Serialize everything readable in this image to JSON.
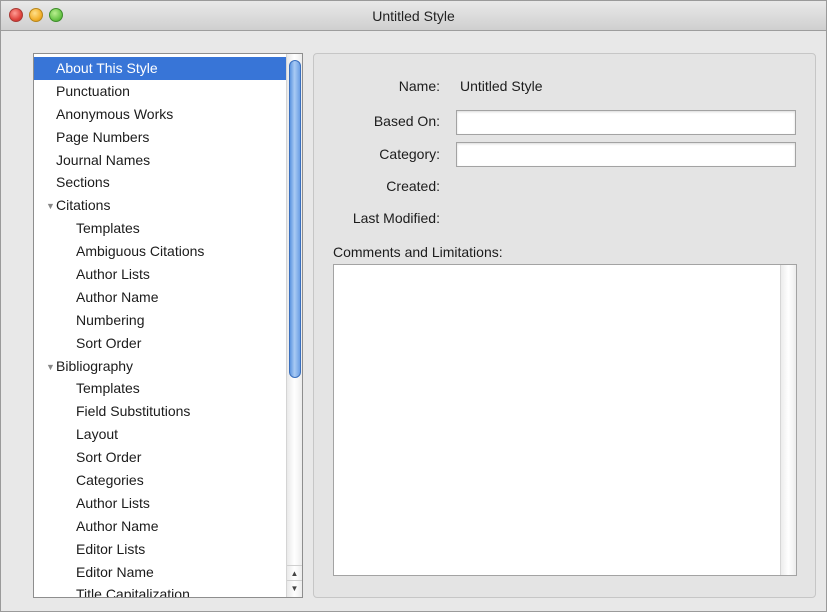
{
  "window": {
    "title": "Untitled Style"
  },
  "sidebar": {
    "items": [
      {
        "label": "About This Style",
        "level": 0,
        "selected": true
      },
      {
        "label": "Punctuation",
        "level": 0
      },
      {
        "label": "Anonymous Works",
        "level": 0
      },
      {
        "label": "Page Numbers",
        "level": 0
      },
      {
        "label": "Journal Names",
        "level": 0
      },
      {
        "label": "Sections",
        "level": 0
      },
      {
        "label": "Citations",
        "level": 0,
        "expanded": true
      },
      {
        "label": "Templates",
        "level": 1
      },
      {
        "label": "Ambiguous Citations",
        "level": 1
      },
      {
        "label": "Author Lists",
        "level": 1
      },
      {
        "label": "Author Name",
        "level": 1
      },
      {
        "label": "Numbering",
        "level": 1
      },
      {
        "label": "Sort Order",
        "level": 1
      },
      {
        "label": "Bibliography",
        "level": 0,
        "expanded": true
      },
      {
        "label": "Templates",
        "level": 1
      },
      {
        "label": "Field Substitutions",
        "level": 1
      },
      {
        "label": "Layout",
        "level": 1
      },
      {
        "label": "Sort Order",
        "level": 1
      },
      {
        "label": "Categories",
        "level": 1
      },
      {
        "label": "Author Lists",
        "level": 1
      },
      {
        "label": "Author Name",
        "level": 1
      },
      {
        "label": "Editor Lists",
        "level": 1
      },
      {
        "label": "Editor Name",
        "level": 1
      },
      {
        "label": "Title Capitalization",
        "level": 1
      }
    ],
    "disclosure_glyph": "▼",
    "scroll_up_glyph": "▲",
    "scroll_down_glyph": "▼"
  },
  "form": {
    "name_label": "Name:",
    "name_value": "Untitled Style",
    "based_on_label": "Based On:",
    "based_on_value": "",
    "category_label": "Category:",
    "category_value": "",
    "created_label": "Created:",
    "last_modified_label": "Last Modified:",
    "comments_label": "Comments and Limitations:",
    "comments_value": ""
  },
  "colors": {
    "selection": "#3875d7",
    "close": "#e0443e",
    "minimize": "#f3b12d",
    "zoom": "#6cc64a"
  }
}
